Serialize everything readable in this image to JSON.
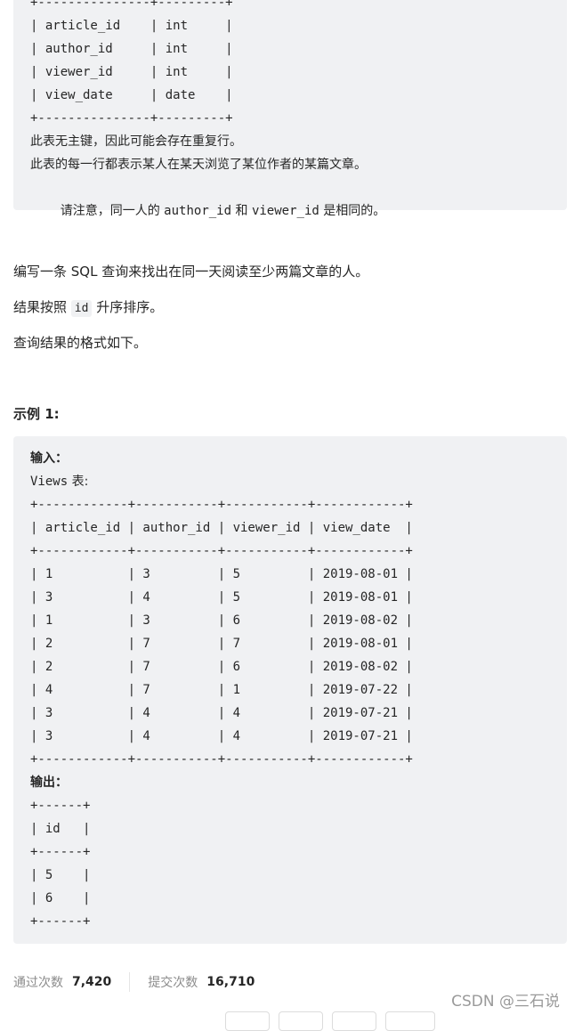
{
  "schema_block": {
    "border_top": "+---------------+---------+",
    "rows": [
      "| article_id    | int     |",
      "| author_id     | int     |",
      "| viewer_id     | int     |",
      "| view_date     | date    |"
    ],
    "border_bottom": "+---------------+---------+",
    "notes": [
      "此表无主键，因此可能会存在重复行。",
      "此表的每一行都表示某人在某天浏览了某位作者的某篇文章。"
    ],
    "note3": {
      "prefix": "请注意，同一人的 ",
      "code1": "author_id",
      "mid": " 和 ",
      "code2": "viewer_id",
      "suffix": " 是相同的。"
    }
  },
  "description": {
    "line1": "编写一条 SQL 查询来找出在同一天阅读至少两篇文章的人。",
    "line2_prefix": "结果按照 ",
    "line2_code": "id",
    "line2_suffix": " 升序排序。",
    "line3": "查询结果的格式如下。"
  },
  "example": {
    "title": "示例 1:",
    "input_label": "输入：",
    "table_label_code": "Views",
    "table_label_cn": " 表:",
    "input_border": "+------------+-----------+-----------+------------+",
    "input_header": "| article_id | author_id | viewer_id | view_date  |",
    "input_rows": [
      "| 1          | 3         | 5         | 2019-08-01 |",
      "| 3          | 4         | 5         | 2019-08-01 |",
      "| 1          | 3         | 6         | 2019-08-02 |",
      "| 2          | 7         | 7         | 2019-08-01 |",
      "| 2          | 7         | 6         | 2019-08-02 |",
      "| 4          | 7         | 1         | 2019-07-22 |",
      "| 3          | 4         | 4         | 2019-07-21 |",
      "| 3          | 4         | 4         | 2019-07-21 |"
    ],
    "output_label": "输出：",
    "output_border": "+------+",
    "output_header": "| id   |",
    "output_rows": [
      "| 5    |",
      "| 6    |"
    ]
  },
  "stats": {
    "accepted_label": "通过次数",
    "accepted_value": "7,420",
    "submitted_label": "提交次数",
    "submitted_value": "16,710"
  },
  "watermark": "CSDN @三石说"
}
